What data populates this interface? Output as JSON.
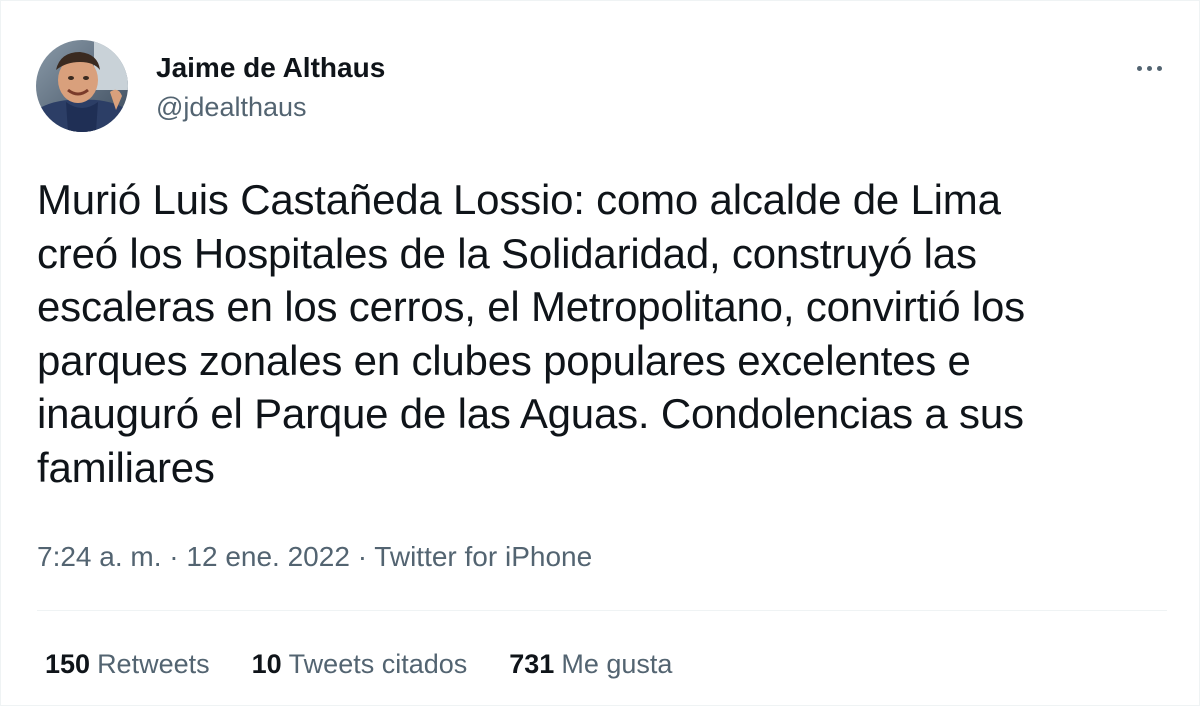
{
  "author": {
    "name": "Jaime de Althaus",
    "handle": "@jdealthaus"
  },
  "tweet": {
    "lines": [
      "Murió Luis Castañeda Lossio: como alcalde de Lima",
      "creó los Hospitales de la Solidaridad, construyó las",
      "escaleras en los cerros, el Metropolitano, convirtió los",
      "parques zonales en clubes populares excelentes e",
      "inauguró el Parque de las Aguas. Condolencias a sus",
      "familiares"
    ]
  },
  "meta": {
    "time": "7:24 a. m.",
    "separator": "·",
    "date": "12 ene. 2022",
    "source": "Twitter for iPhone"
  },
  "stats": [
    {
      "count": "150",
      "label": "Retweets"
    },
    {
      "count": "10",
      "label": "Tweets citados"
    },
    {
      "count": "731",
      "label": "Me gusta"
    }
  ],
  "icons": {
    "more": "more-horizontal-icon",
    "avatar": "avatar"
  },
  "colors": {
    "text": "#0f1419",
    "secondary": "#536471",
    "divider": "#eff3f4"
  }
}
